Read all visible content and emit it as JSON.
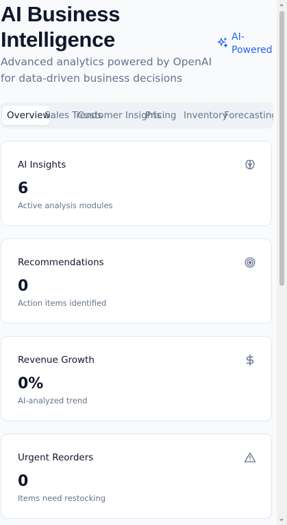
{
  "header": {
    "title": "AI Business Intelligence",
    "subtitle": "Advanced analytics powered by OpenAI for data-driven business decisions",
    "badge_label": "AI-Powered",
    "badge_icon": "sparkles-icon"
  },
  "tabs": [
    {
      "label": "Overview",
      "active": true
    },
    {
      "label": "Sales Trends",
      "active": false
    },
    {
      "label": "Customer Insights",
      "active": false
    },
    {
      "label": "Pricing",
      "active": false
    },
    {
      "label": "Inventory",
      "active": false
    },
    {
      "label": "Forecasting",
      "active": false
    }
  ],
  "cards": [
    {
      "title": "AI Insights",
      "value": "6",
      "caption": "Active analysis modules",
      "icon": "brain-icon"
    },
    {
      "title": "Recommendations",
      "value": "0",
      "caption": "Action items identified",
      "icon": "target-icon"
    },
    {
      "title": "Revenue Growth",
      "value": "0%",
      "caption": "AI-analyzed trend",
      "icon": "dollar-sign-icon"
    },
    {
      "title": "Urgent Reorders",
      "value": "0",
      "caption": "Items need restocking",
      "icon": "alert-triangle-icon"
    }
  ],
  "colors": {
    "accent": "#2563eb",
    "background": "#f8fafc",
    "card": "#ffffff",
    "muted_text": "#64748b",
    "text": "#0f172a"
  }
}
